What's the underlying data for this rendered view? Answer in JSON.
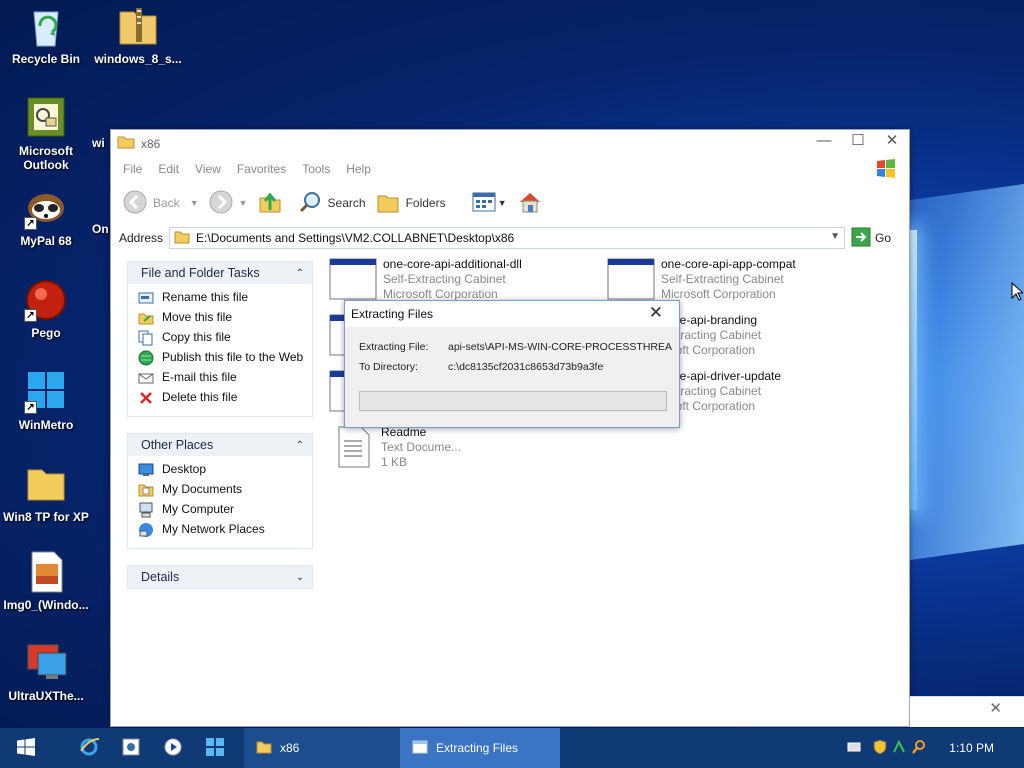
{
  "desktop": {
    "icons": [
      {
        "label": "Recycle Bin",
        "icon": "recycle-bin-icon"
      },
      {
        "label": "windows_8_s...",
        "icon": "zip-folder-icon"
      },
      {
        "label": "Microsoft Outlook",
        "icon": "outlook-icon"
      },
      {
        "label": "wi",
        "icon": "iobit-icon"
      },
      {
        "label": "MyPal 68",
        "icon": "mypal-icon"
      },
      {
        "label": "On",
        "icon": "partial-icon"
      },
      {
        "label": "Pego",
        "icon": "pego-icon"
      },
      {
        "label": "WinMetro",
        "icon": "winmetro-icon"
      },
      {
        "label": "Win8 TP for XP",
        "icon": "folder-icon"
      },
      {
        "label": "Img0_(Windo...",
        "icon": "image-file-icon"
      },
      {
        "label": "UltraUXThe...",
        "icon": "ultraux-icon"
      }
    ]
  },
  "explorer": {
    "title": "x86",
    "menu": [
      "File",
      "Edit",
      "View",
      "Favorites",
      "Tools",
      "Help"
    ],
    "toolbar": {
      "back": "Back",
      "search": "Search",
      "folders": "Folders"
    },
    "address": {
      "label": "Address",
      "value": "E:\\Documents and Settings\\VM2.COLLABNET\\Desktop\\x86",
      "go": "Go"
    },
    "tasks": {
      "file_folder": {
        "header": "File and Folder Tasks",
        "items": [
          "Rename this file",
          "Move this file",
          "Copy this file",
          "Publish this file to the Web",
          "E-mail this file",
          "Delete this file"
        ]
      },
      "other_places": {
        "header": "Other Places",
        "items": [
          "Desktop",
          "My Documents",
          "My Computer",
          "My Network Places"
        ]
      },
      "details": {
        "header": "Details"
      }
    },
    "files": [
      {
        "name": "one-core-api-additional-dll",
        "type": "Self-Extracting Cabinet",
        "company": "Microsoft Corporation"
      },
      {
        "name": "one-core-api-app-compat",
        "type": "Self-Extracting Cabinet",
        "company": "Microsoft Corporation"
      },
      {
        "name": "",
        "type": "",
        "company": ""
      },
      {
        "name": "-core-api-branding",
        "type": "-Extracting Cabinet",
        "company": "rosoft Corporation"
      },
      {
        "name": "",
        "type": "",
        "company": ""
      },
      {
        "name": "-core-api-driver-update",
        "type": "-Extracting Cabinet",
        "company": "rosoft Corporation"
      },
      {
        "name": "Readme",
        "type": "Text Docume...",
        "company": "1 KB"
      }
    ]
  },
  "dialog": {
    "title": "Extracting Files",
    "file_label": "Extracting File:",
    "file_value": "api-sets\\API-MS-WIN-CORE-PROCESSTHREA",
    "dir_label": "To Directory:",
    "dir_value": "c:\\dc8135cf2031c8653d73b9a3fe",
    "progress": 0
  },
  "taskbar": {
    "tasks": [
      {
        "label": "x86",
        "active": false
      },
      {
        "label": "Extracting Files",
        "active": true
      }
    ],
    "clock": "1:10 PM"
  }
}
